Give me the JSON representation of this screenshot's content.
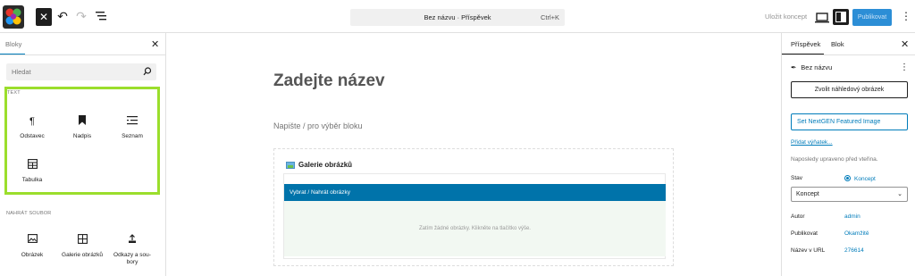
{
  "topbar": {
    "command_title": "Bez názvu · Příspěvek",
    "command_shortcut": "Ctrl+K",
    "save_draft": "Uložit koncept",
    "publish": "Publikovat"
  },
  "inserter": {
    "tab": "Bloky",
    "search_placeholder": "Hledat",
    "text_category": "TEXT",
    "text_blocks": [
      {
        "label": "Odstavec",
        "icon": "paragraph-icon"
      },
      {
        "label": "Nadpis",
        "icon": "heading-icon"
      },
      {
        "label": "Seznam",
        "icon": "list-icon"
      },
      {
        "label": "Tabulka",
        "icon": "table-icon"
      }
    ],
    "media_category": "NAHRÁT SOUBOR",
    "media_blocks": [
      {
        "label": "Obrázek",
        "icon": "image-icon"
      },
      {
        "label": "Galerie obrázků",
        "icon": "gallery-icon"
      },
      {
        "label": "Odkazy a sou-bory",
        "icon": "file-icon"
      }
    ],
    "highlight_color": "#9bde2c"
  },
  "editor": {
    "title_placeholder": "Zadejte název",
    "block_placeholder": "Napište / pro výběr bloku",
    "gallery": {
      "title": "Galerie obrázků",
      "button": "Vybrat / Nahrát obrázky",
      "empty_text": "Zatím žádné obrázky. Klikněte na tlačítko výše."
    }
  },
  "sidebar": {
    "tabs": [
      "Příspěvek",
      "Blok"
    ],
    "document_title": "Bez názvu",
    "featured_image_button": "Zvolit náhledový obrázek",
    "nextgen_button": "Set NextGEN Featured Image",
    "add_excerpt": "Přidat výňatek...",
    "last_edited": "Naposledy upraveno před vteřina.",
    "status_label": "Stav",
    "status_value": "Koncept",
    "status_select": "Koncept",
    "author_label": "Autor",
    "author_value": "admin",
    "publish_label": "Publikovat",
    "publish_value": "Okamžitě",
    "slug_label": "Název v URL",
    "slug_value": "276614"
  }
}
